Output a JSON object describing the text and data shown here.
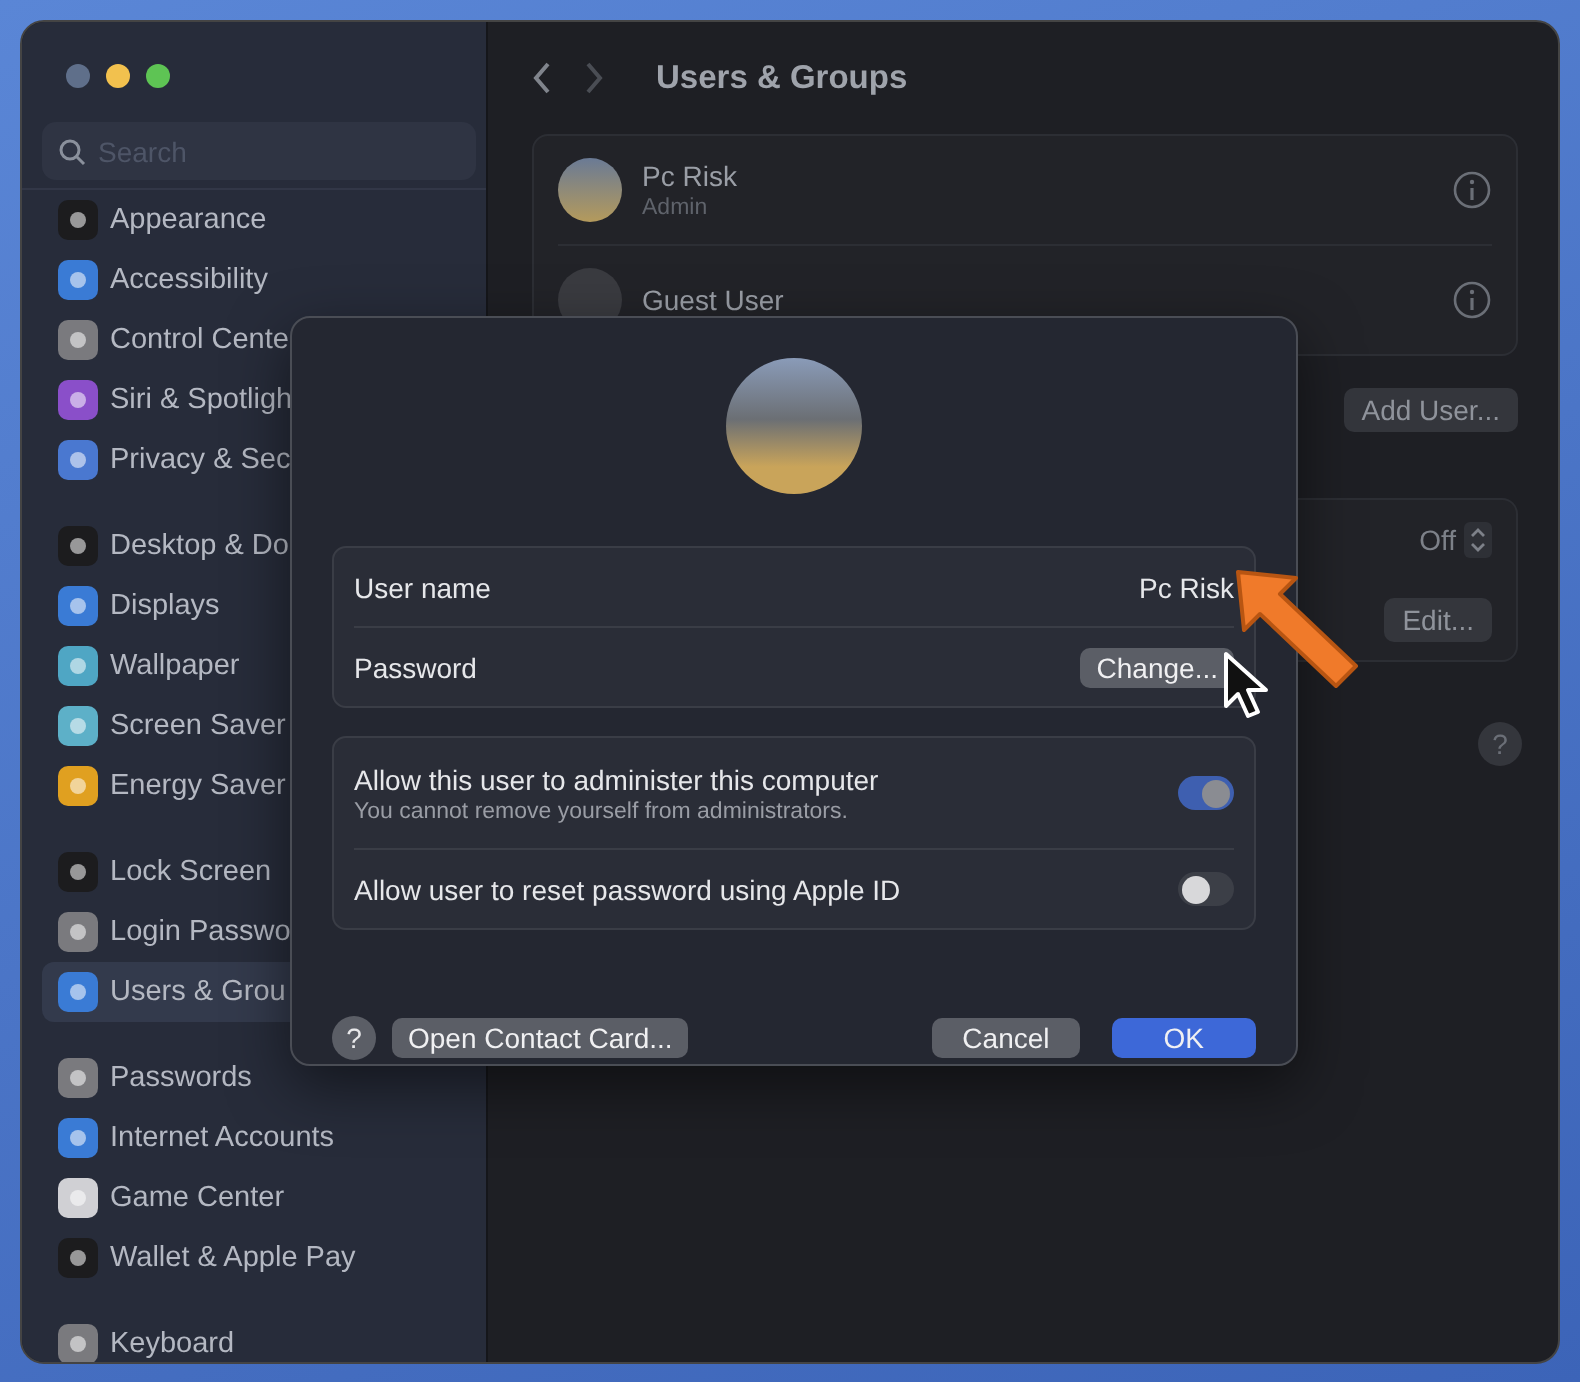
{
  "window": {
    "title": "Users & Groups"
  },
  "sidebar": {
    "search": {
      "placeholder": "Search"
    },
    "sections": [
      {
        "items": [
          {
            "label": "Appearance",
            "color": "#1c1c1e",
            "selected": false
          },
          {
            "label": "Accessibility",
            "color": "#3a7bd5",
            "selected": false
          },
          {
            "label": "Control Cente",
            "color": "#7a7a7e",
            "selected": false
          },
          {
            "label": "Siri & Spotligh",
            "color": "#8a4fc9",
            "selected": false
          },
          {
            "label": "Privacy & Sec",
            "color": "#4a78d0",
            "selected": false
          }
        ]
      },
      {
        "items": [
          {
            "label": "Desktop & Do",
            "color": "#1c1c1e",
            "selected": false
          },
          {
            "label": "Displays",
            "color": "#3a7bd5",
            "selected": false
          },
          {
            "label": "Wallpaper",
            "color": "#4fa6c4",
            "selected": false
          },
          {
            "label": "Screen Saver",
            "color": "#5db0c8",
            "selected": false
          },
          {
            "label": "Energy Saver",
            "color": "#e0a020",
            "selected": false
          }
        ]
      },
      {
        "items": [
          {
            "label": "Lock Screen",
            "color": "#1c1c1e",
            "selected": false
          },
          {
            "label": "Login Passwo",
            "color": "#7a7a7e",
            "selected": false
          },
          {
            "label": "Users & Grou",
            "color": "#3a7bd5",
            "selected": true
          }
        ]
      },
      {
        "items": [
          {
            "label": "Passwords",
            "color": "#7a7a7e",
            "selected": false
          },
          {
            "label": "Internet Accounts",
            "color": "#3a7bd5",
            "selected": false
          },
          {
            "label": "Game Center",
            "color": "#d0d0d4",
            "selected": false
          },
          {
            "label": "Wallet & Apple Pay",
            "color": "#1c1c1e",
            "selected": false
          }
        ]
      },
      {
        "items": [
          {
            "label": "Keyboard",
            "color": "#7a7a7e",
            "selected": false
          }
        ]
      }
    ]
  },
  "users": [
    {
      "name": "Pc Risk",
      "role": "Admin"
    },
    {
      "name": "Guest User"
    }
  ],
  "add_user_button": "Add User...",
  "settings": [
    {
      "kind": "stepper",
      "value": "Off"
    },
    {
      "kind": "button",
      "value": "Edit..."
    }
  ],
  "help_button": "?",
  "dialog": {
    "fields": [
      {
        "label": "User name",
        "kind": "text",
        "value": "Pc Risk"
      },
      {
        "label": "Password",
        "kind": "button",
        "value": "Change..."
      }
    ],
    "toggles": [
      {
        "label": "Allow this user to administer this computer",
        "note": "You cannot remove yourself from administrators.",
        "on": true
      },
      {
        "label": "Allow user to reset password using Apple ID",
        "on": false
      }
    ],
    "help_button": "?",
    "contact_button": "Open Contact Card...",
    "cancel_button": "Cancel",
    "ok_button": "OK"
  }
}
